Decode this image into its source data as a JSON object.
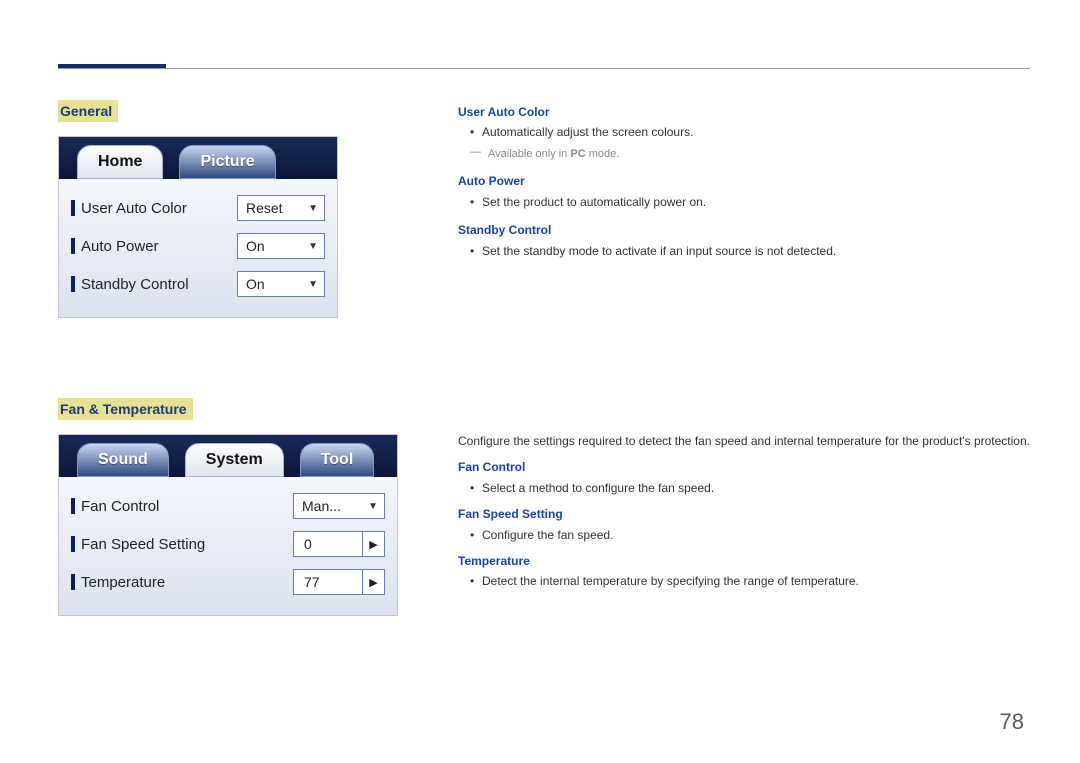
{
  "page_number": "78",
  "sections": {
    "general": {
      "heading": "General",
      "tabs": {
        "home": "Home",
        "picture": "Picture"
      },
      "rows": {
        "user_auto_color": {
          "label": "User Auto Color",
          "value": "Reset"
        },
        "auto_power": {
          "label": "Auto Power",
          "value": "On"
        },
        "standby_control": {
          "label": "Standby Control",
          "value": "On"
        }
      },
      "text": {
        "uac_head": "User Auto Color",
        "uac_bullet": "Automatically adjust the screen colours.",
        "uac_note_pre": "Available only in ",
        "uac_note_bold": "PC",
        "uac_note_post": " mode.",
        "ap_head": "Auto Power",
        "ap_bullet": "Set the product to automatically power on.",
        "sc_head": "Standby Control",
        "sc_bullet": "Set the standby mode to activate if an input source is not detected."
      }
    },
    "fan": {
      "heading": "Fan & Temperature",
      "tabs": {
        "sound": "Sound",
        "system": "System",
        "tool": "Tool"
      },
      "rows": {
        "fan_control": {
          "label": "Fan Control",
          "value": "Man..."
        },
        "fan_speed": {
          "label": "Fan Speed Setting",
          "value": "0"
        },
        "temperature": {
          "label": "Temperature",
          "value": "77"
        }
      },
      "text": {
        "intro": "Configure the settings required to detect the fan speed and internal temperature for the product's protection.",
        "fc_head": "Fan Control",
        "fc_bullet": "Select a method to configure the fan speed.",
        "fss_head": "Fan Speed Setting",
        "fss_bullet": "Configure the fan speed.",
        "t_head": "Temperature",
        "t_bullet": "Detect the internal temperature by specifying the range of temperature."
      }
    }
  }
}
